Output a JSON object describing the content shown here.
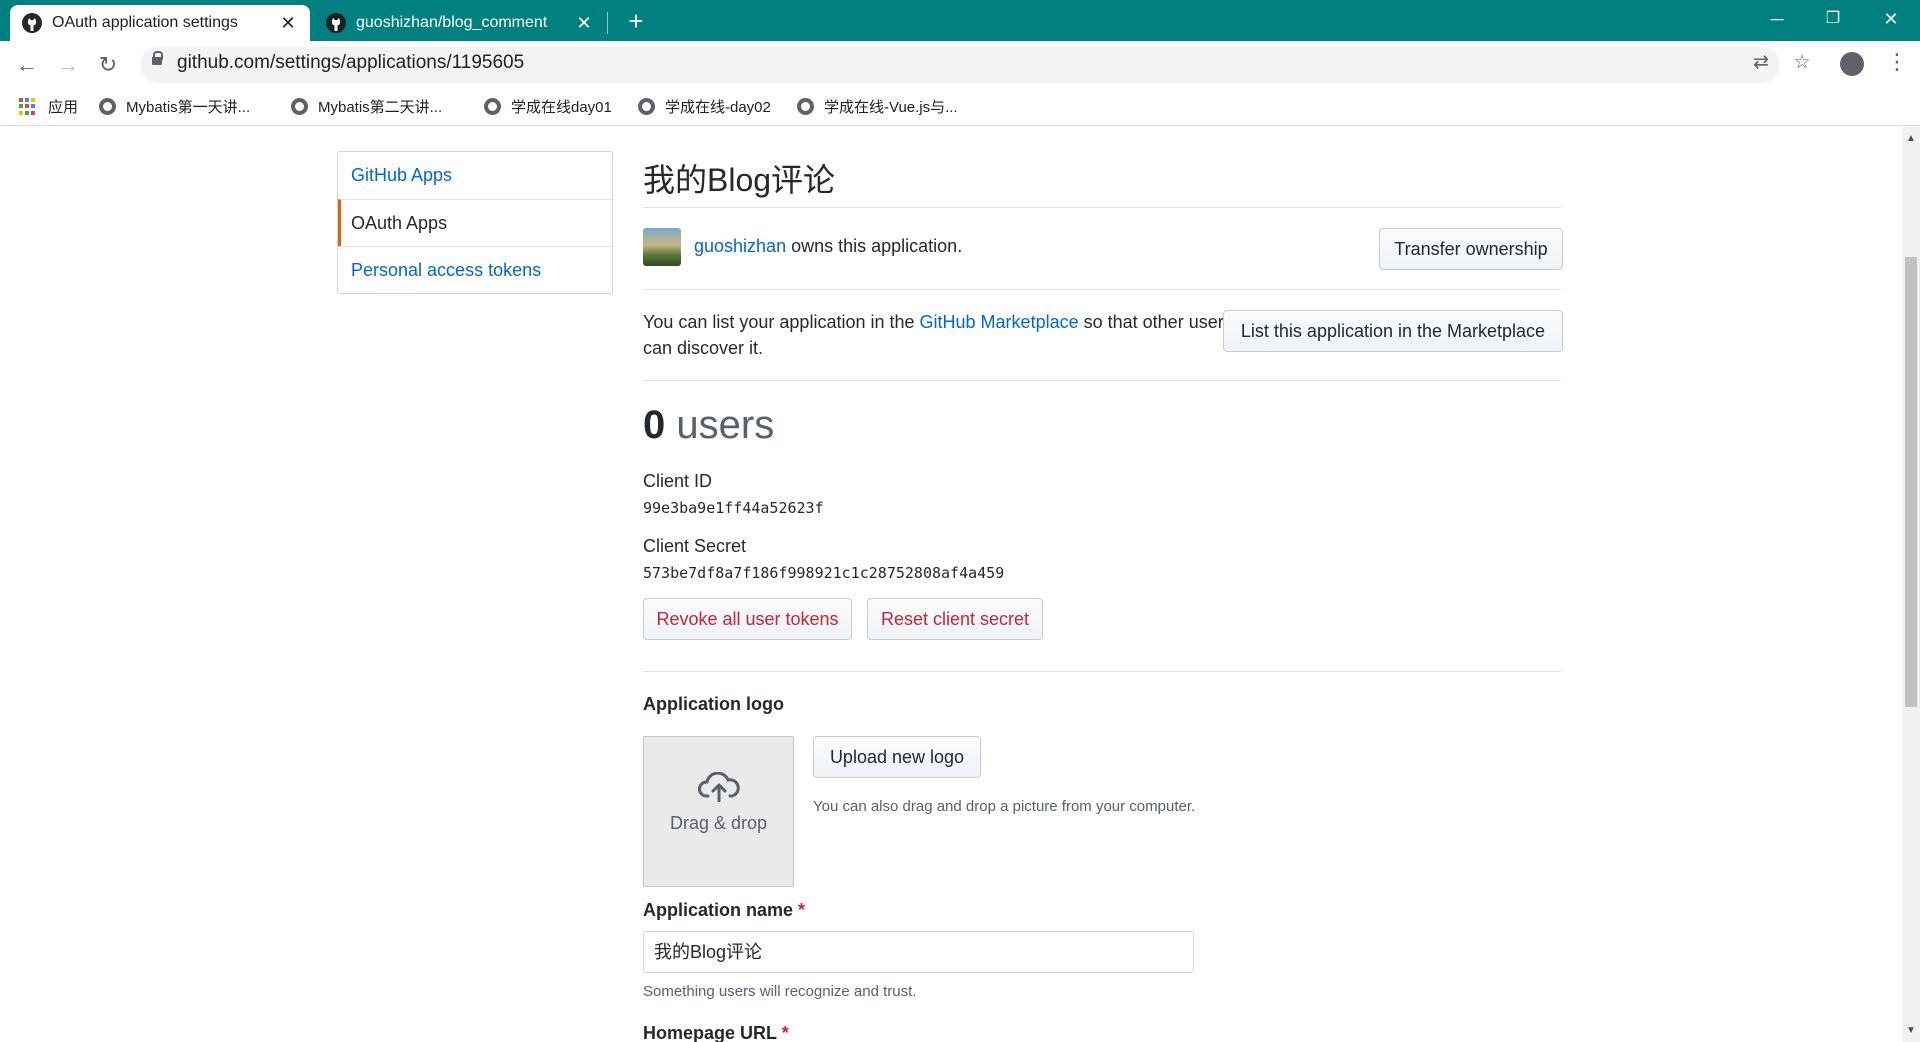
{
  "browser": {
    "tabs": [
      {
        "title": "OAuth application settings",
        "active": true
      },
      {
        "title": "guoshizhan/blog_comment",
        "active": false
      }
    ],
    "url": "github.com/settings/applications/1195605",
    "bookmarks": [
      {
        "label": "应用"
      },
      {
        "label": "Mybatis第一天讲..."
      },
      {
        "label": "Mybatis第二天讲..."
      },
      {
        "label": "学成在线day01"
      },
      {
        "label": "学成在线-day02"
      },
      {
        "label": "学成在线-Vue.js与..."
      }
    ],
    "colors": {
      "tabstrip": "#00807f"
    }
  },
  "sidebar": {
    "items": [
      {
        "label": "GitHub Apps",
        "selected": false
      },
      {
        "label": "OAuth Apps",
        "selected": true
      },
      {
        "label": "Personal access tokens",
        "selected": false
      }
    ]
  },
  "app": {
    "title": "我的Blog评论",
    "owner": {
      "username": "guoshizhan",
      "suffix": "owns this application."
    },
    "transfer_button": "Transfer ownership",
    "marketplace": {
      "prefix": "You can list your application in the",
      "link": "GitHub Marketplace",
      "suffix_line1": "so that other users",
      "suffix_line2": "can discover it.",
      "button": "List this application in the Marketplace"
    },
    "users": {
      "count": "0",
      "label": "users"
    },
    "client_id": {
      "label": "Client ID",
      "value": "99e3ba9e1ff44a52623f"
    },
    "client_secret": {
      "label": "Client Secret",
      "value": "573be7df8a7f186f998921c1c28752808af4a459"
    },
    "revoke_button": "Revoke all user tokens",
    "reset_button": "Reset client secret",
    "logo": {
      "label": "Application logo",
      "dropzone_text": "Drag & drop",
      "upload_button": "Upload new logo",
      "note": "You can also drag and drop a picture from your computer."
    },
    "name_field": {
      "label": "Application name",
      "required_mark": "*",
      "value": "我的Blog评论",
      "note": "Something users will recognize and trust."
    },
    "homepage_field": {
      "label": "Homepage URL",
      "required_mark": "*"
    }
  }
}
